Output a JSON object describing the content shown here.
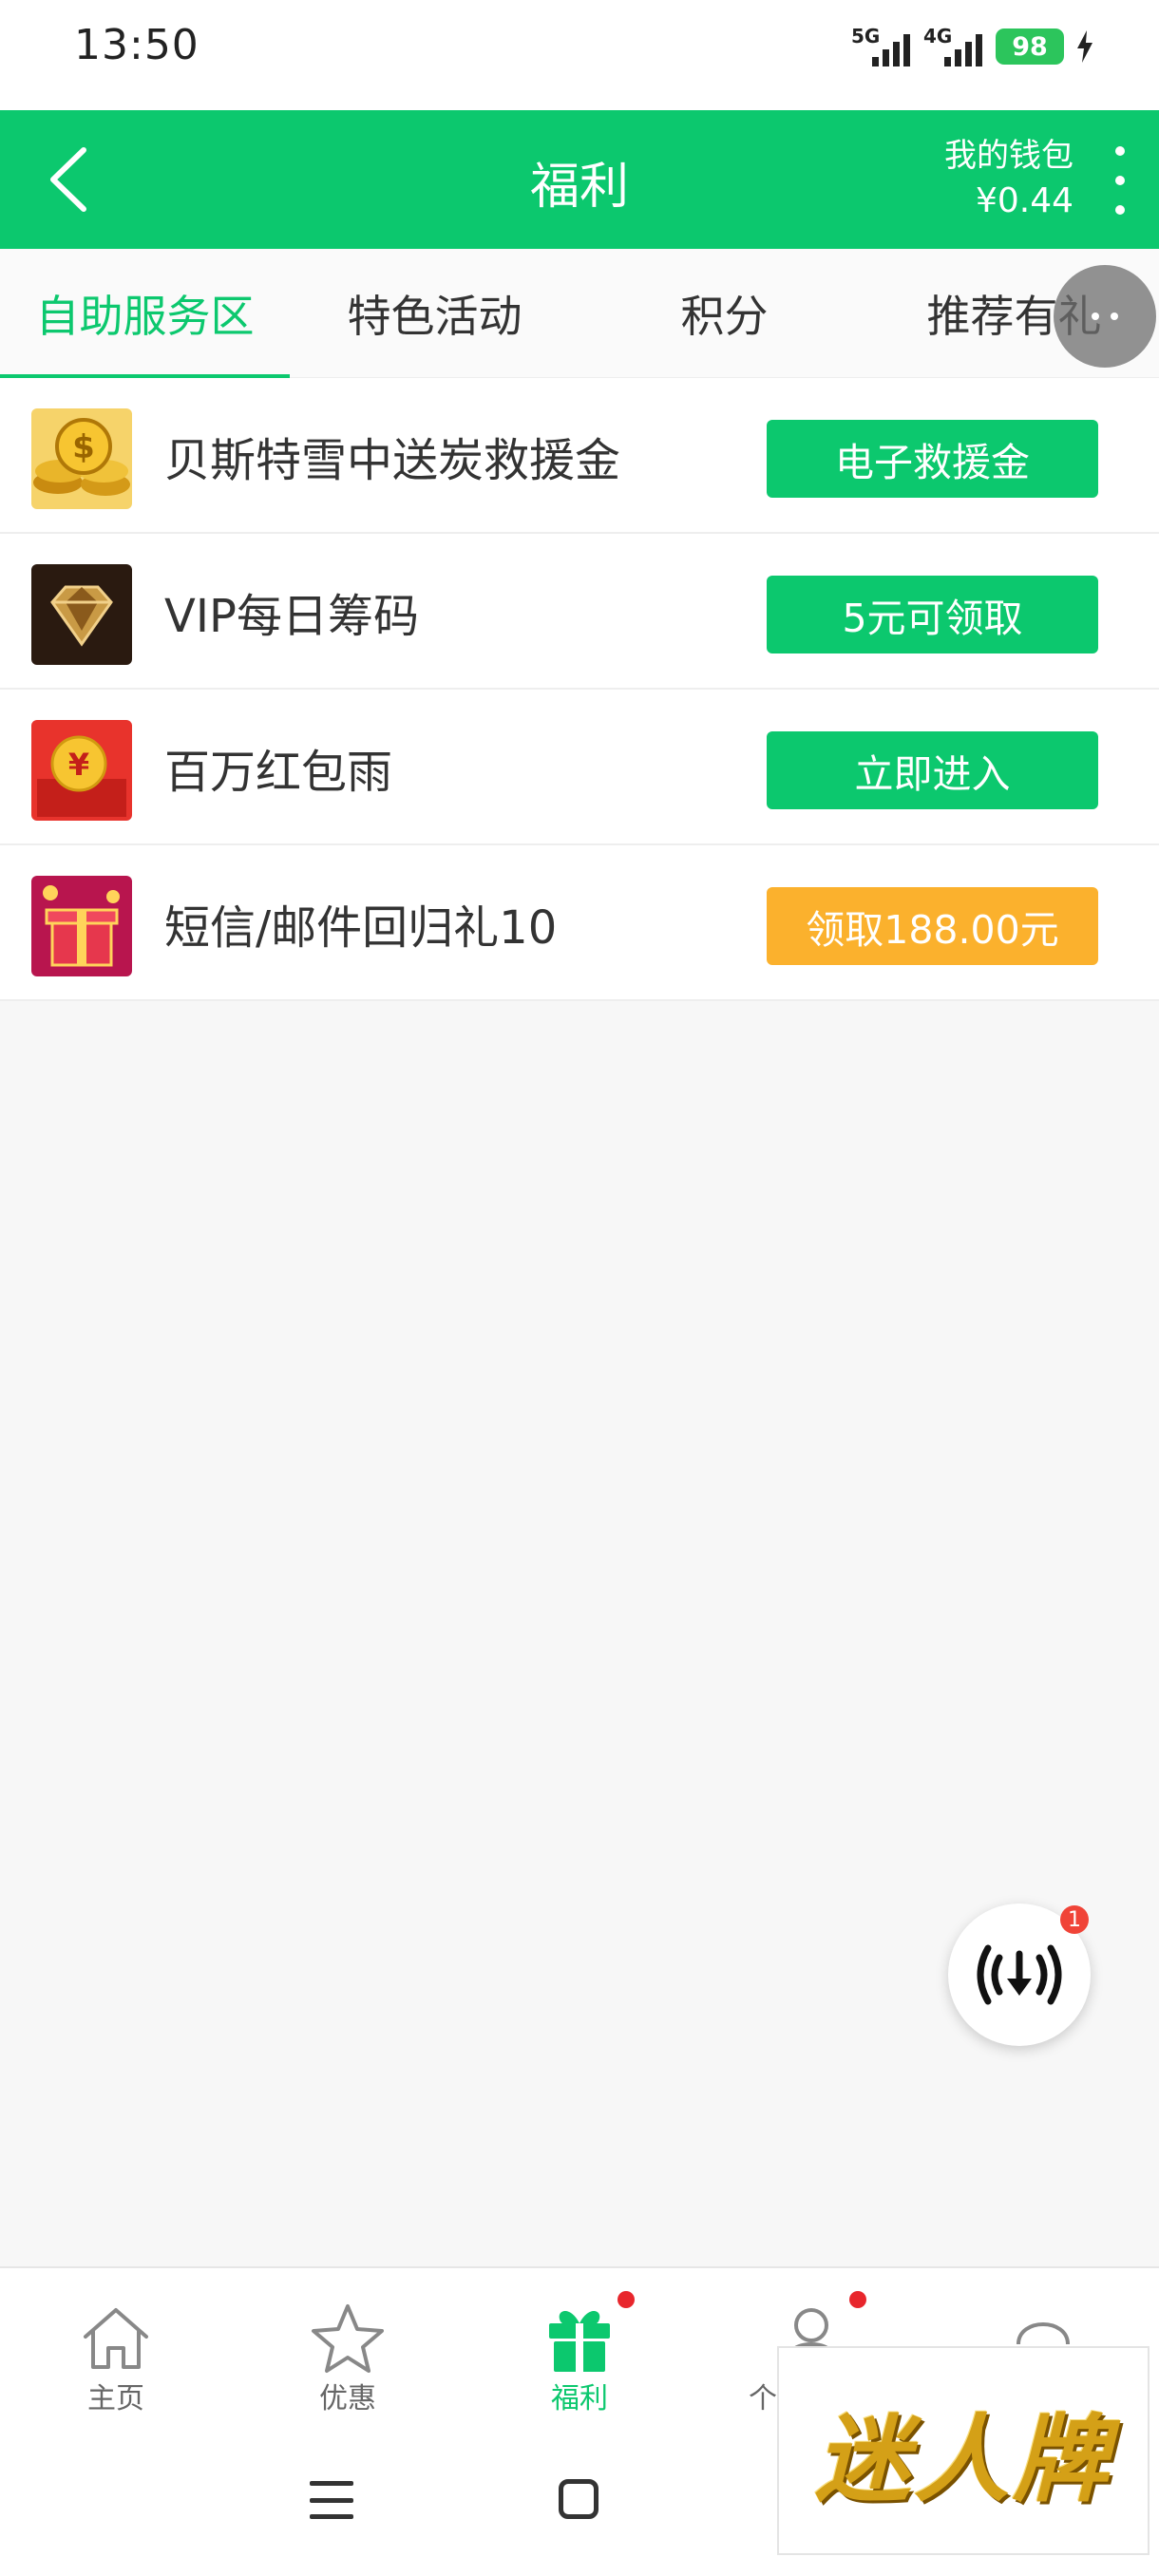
{
  "status_bar": {
    "time": "13:50",
    "network1": "5G",
    "network2": "4G",
    "battery": "98"
  },
  "header": {
    "back_icon": "chevron-left-icon",
    "title": "福利",
    "wallet_label": "我的钱包",
    "wallet_amount": "¥0.44",
    "more_icon": "more-vertical-icon",
    "color": "#0cc86e"
  },
  "tabs": [
    {
      "label": "自助服务区",
      "active": true
    },
    {
      "label": "特色活动",
      "active": false
    },
    {
      "label": "积分",
      "active": false
    },
    {
      "label": "推荐有礼",
      "active": false
    }
  ],
  "list": [
    {
      "title": "贝斯特雪中送炭救援金",
      "icon": "gold-coins-icon",
      "button": "电子救援金",
      "button_color": "#0cc86e"
    },
    {
      "title": "VIP每日筹码",
      "icon": "diamond-icon",
      "button": "5元可领取",
      "button_color": "#0cc86e"
    },
    {
      "title": "百万红包雨",
      "icon": "red-envelope-icon",
      "button": "立即进入",
      "button_color": "#0cc86e"
    },
    {
      "title": "短信/邮件回归礼10",
      "icon": "gift-box-icon",
      "button": "领取188.00元",
      "button_color": "#fbb12d"
    }
  ],
  "download_badge": "1",
  "bottom_nav": [
    {
      "label": "主页",
      "icon": "home-icon",
      "active": false,
      "dot": false
    },
    {
      "label": "优惠",
      "icon": "star-icon",
      "active": false,
      "dot": false
    },
    {
      "label": "福利",
      "icon": "gift-icon",
      "active": true,
      "dot": true
    },
    {
      "label": "个",
      "icon": "person-icon",
      "active": false,
      "dot": true
    },
    {
      "label": "",
      "icon": "headset-icon",
      "active": false,
      "dot": false
    }
  ],
  "watermark": "迷人牌"
}
